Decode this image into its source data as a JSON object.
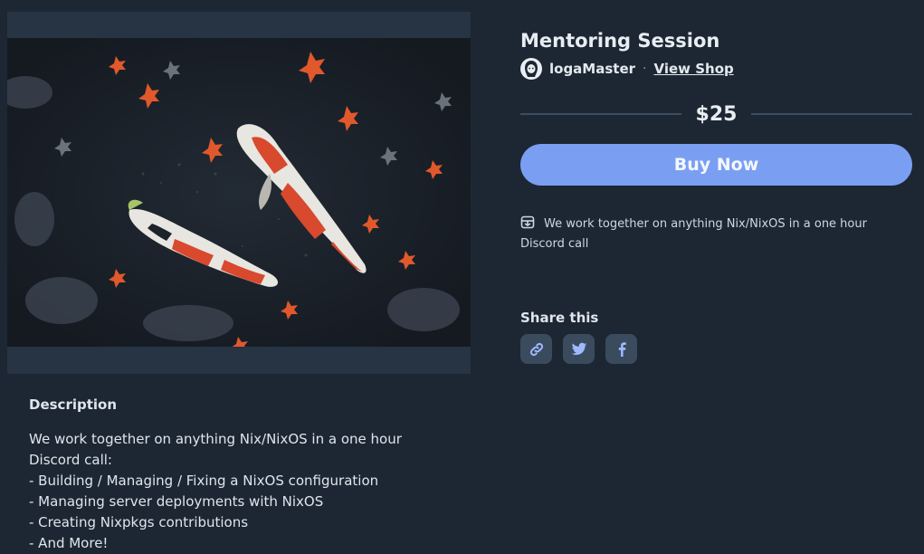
{
  "product": {
    "title": "Mentoring Session",
    "seller_name": "logaMaster",
    "separator": "·",
    "view_shop_label": "View Shop",
    "price": "$25",
    "buy_label": "Buy Now",
    "summary": "We work together on anything Nix/NixOS in a one hour Discord call"
  },
  "image": {
    "subject": "koi-fish-pond-artwork"
  },
  "description": {
    "heading": "Description",
    "lines": [
      "We work together on anything Nix/NixOS in a one hour Discord call:",
      "- Building / Managing / Fixing a NixOS configuration",
      "- Managing server deployments with NixOS",
      "- Creating Nixpkgs contributions",
      "- And More!"
    ]
  },
  "share": {
    "heading": "Share this",
    "buttons": [
      "link-icon",
      "twitter-icon",
      "facebook-icon"
    ]
  },
  "colors": {
    "background": "#1d2733",
    "accent": "#7a9ff2",
    "share_button": "#3a4b5d"
  }
}
